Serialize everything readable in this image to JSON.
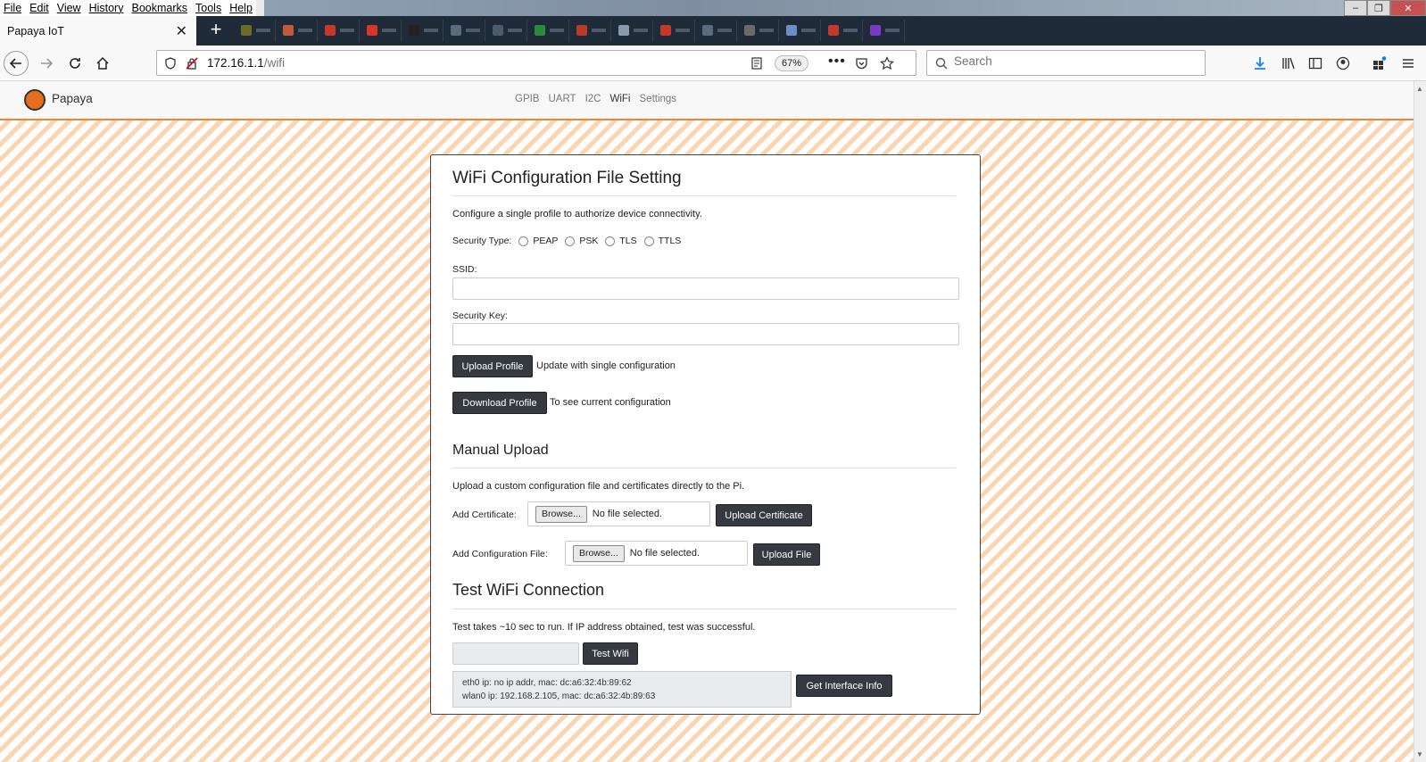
{
  "browser": {
    "menu": [
      "File",
      "Edit",
      "View",
      "History",
      "Bookmarks",
      "Tools",
      "Help"
    ],
    "active_tab_title": "Papaya IoT",
    "url_host": "172.16.1.1",
    "url_path": "/wifi",
    "zoom": "67%",
    "search_placeholder": "Search"
  },
  "app": {
    "brand": "Papaya",
    "nav": [
      "GPIB",
      "UART",
      "I2C",
      "WiFi",
      "Settings"
    ],
    "accent_color": "#e8863c"
  },
  "wifi_config": {
    "title": "WiFi Configuration File Setting",
    "description": "Configure a single profile to authorize device connectivity.",
    "security_type_label": "Security Type:",
    "security_types": [
      "PEAP",
      "PSK",
      "TLS",
      "TTLS"
    ],
    "ssid_label": "SSID:",
    "security_key_label": "Security Key:",
    "upload_profile_button": "Upload Profile",
    "upload_profile_hint": "Update with single configuration",
    "download_profile_button": "Download Profile",
    "download_profile_hint": "To see current configuration"
  },
  "manual_upload": {
    "title": "Manual Upload",
    "description": "Upload a custom configuration file and certificates directly to the Pi.",
    "add_certificate_label": "Add Certificate:",
    "add_config_label": "Add Configuration File:",
    "browse_label": "Browse...",
    "no_file_text": "No file selected.",
    "upload_certificate_button": "Upload Certificate",
    "upload_file_button": "Upload File"
  },
  "test_wifi": {
    "title": "Test WiFi Connection",
    "description": "Test takes ~10 sec to run. If IP address obtained, test was successful.",
    "test_button": "Test Wifi",
    "interface_lines": [
      "eth0 ip: no ip addr, mac: dc:a6:32:4b:89:62",
      "wlan0 ip: 192.168.2.105, mac: dc:a6:32:4b:89:63"
    ],
    "get_info_button": "Get Interface Info"
  }
}
